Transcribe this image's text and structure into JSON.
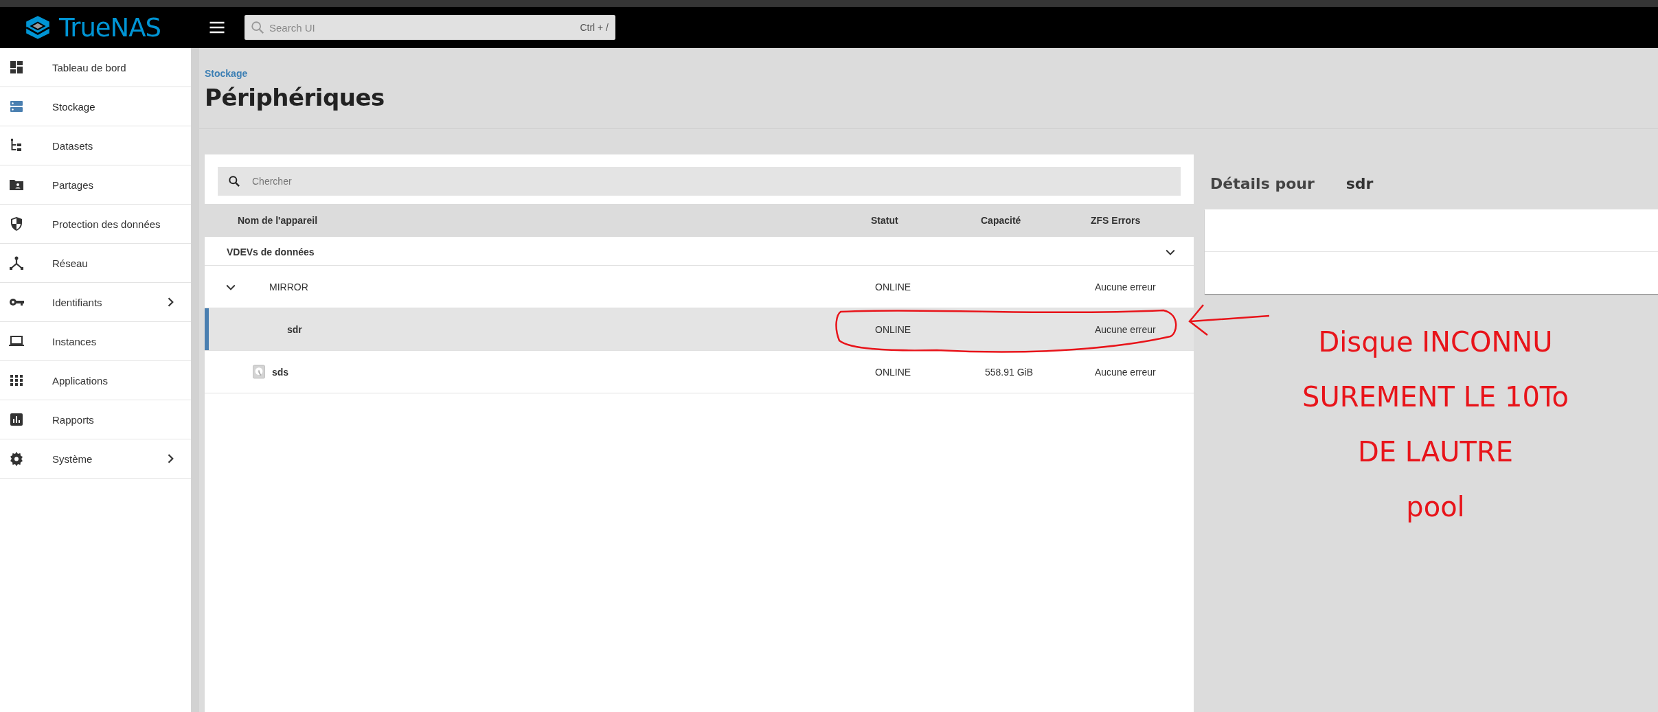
{
  "topbar": {
    "logo": "TrueNAS",
    "search": {
      "placeholder": "Search UI",
      "shortcut": "Ctrl + /"
    }
  },
  "sidebar": {
    "items": [
      {
        "label": "Tableau de bord",
        "selected": false,
        "has_submenu": false
      },
      {
        "label": "Stockage",
        "selected": true,
        "has_submenu": false
      },
      {
        "label": "Datasets",
        "selected": false,
        "has_submenu": false
      },
      {
        "label": "Partages",
        "selected": false,
        "has_submenu": false
      },
      {
        "label": "Protection des données",
        "selected": false,
        "has_submenu": false
      },
      {
        "label": "Réseau",
        "selected": false,
        "has_submenu": false
      },
      {
        "label": "Identifiants",
        "selected": false,
        "has_submenu": true
      },
      {
        "label": "Instances",
        "selected": false,
        "has_submenu": false
      },
      {
        "label": "Applications",
        "selected": false,
        "has_submenu": false
      },
      {
        "label": "Rapports",
        "selected": false,
        "has_submenu": false
      },
      {
        "label": "Système",
        "selected": false,
        "has_submenu": true
      }
    ]
  },
  "page": {
    "breadcrumb": "Stockage",
    "title": "Périphériques"
  },
  "devices": {
    "search": {
      "placeholder": "Chercher"
    },
    "columns": [
      "Nom de l'appareil",
      "Statut",
      "Capacité",
      "ZFS Errors"
    ],
    "rows": [
      {
        "kind": "group",
        "name": "VDEVs de données",
        "expanded": true,
        "selected": false,
        "children": [
          {
            "kind": "vdev",
            "name": "MIRROR",
            "status": "ONLINE",
            "errors": "Aucune erreur",
            "expanded": true,
            "selected": false,
            "children": [
              {
                "kind": "member",
                "name": "sdr",
                "status": "ONLINE",
                "errors": "Aucune erreur",
                "selected": true
              }
            ]
          },
          {
            "kind": "disk",
            "name": "sds",
            "status": "ONLINE",
            "capacity": "558.91 GiB",
            "errors": "Aucune erreur",
            "selected": false
          }
        ]
      }
    ]
  },
  "details": {
    "title": "Détails pour",
    "device": "sdr"
  },
  "annotation": {
    "lines": [
      "Disque INCONNU",
      "SUREMENT LE 10To",
      "DE LAUTRE",
      "pool"
    ]
  }
}
